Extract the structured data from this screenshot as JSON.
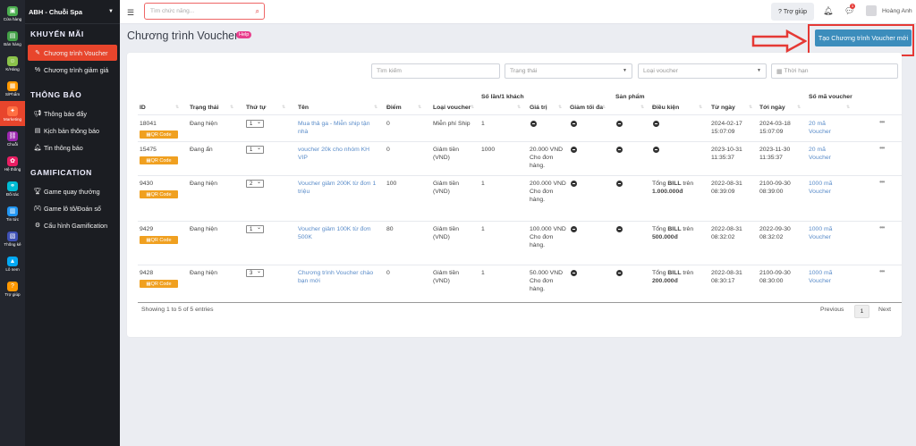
{
  "rail": [
    {
      "label": "Cửa hàng",
      "color": "#4caf50"
    },
    {
      "label": "Bán hàng",
      "color": "#43a047"
    },
    {
      "label": "K/Hàng",
      "color": "#8bc34a"
    },
    {
      "label": "S/Phẩm",
      "color": "#ff9800"
    },
    {
      "label": "Marketing",
      "color": "#ff7043",
      "active": true
    },
    {
      "label": "Chuỗi",
      "color": "#9c27b0"
    },
    {
      "label": "Hệ thống",
      "color": "#e91e63"
    },
    {
      "label": "Đối tác",
      "color": "#00bcd4"
    },
    {
      "label": "Tin tức",
      "color": "#2196f3"
    },
    {
      "label": "Thống kê",
      "color": "#3f51b5"
    },
    {
      "label": "Lô nem",
      "color": "#03a9f4"
    },
    {
      "label": "Trợ giúp",
      "color": "#ff9800"
    }
  ],
  "brand": "ABH - Chuỗi Spa",
  "sidebar": {
    "sections": [
      {
        "title": "KHUYẾN MÃI",
        "items": [
          {
            "label": "Chương trình Voucher",
            "icon": "tag-icon",
            "active": true
          },
          {
            "label": "Chương trình giảm giá",
            "icon": "percent-icon"
          }
        ]
      },
      {
        "title": "THÔNG BÁO",
        "items": [
          {
            "label": "Thông báo đẩy",
            "icon": "megaphone-icon"
          },
          {
            "label": "Kịch bản thông báo",
            "icon": "script-icon"
          },
          {
            "label": "Tin thông báo",
            "icon": "bell-icon"
          }
        ]
      },
      {
        "title": "GAMIFICATION",
        "items": [
          {
            "label": "Game quay thưởng",
            "icon": "trophy-icon"
          },
          {
            "label": "Game lô tô/Đoán số",
            "icon": "gamepad-icon"
          },
          {
            "label": "Cấu hình Gamification",
            "icon": "gear-icon"
          }
        ]
      }
    ]
  },
  "topbar": {
    "search_placeholder": "Tìm chức năng...",
    "help": "Trợ giúp",
    "user": "Hoàng Anh",
    "chat_badge": "1"
  },
  "page": {
    "title": "Chương trình Voucher",
    "help_badge": "Help",
    "create_button": "Tạo Chương trình Voucher mới"
  },
  "filters": {
    "search": "Tìm kiếm",
    "status": "Trạng thái",
    "type": "Loại voucher",
    "period": "Thời hạn"
  },
  "columns": [
    "ID",
    "Trạng thái",
    "Thứ tự",
    "Tên",
    "Điểm",
    "Loại voucher",
    "Số lần/1 khách",
    "Giá trị",
    "Giảm tối đa",
    "Sản phẩm",
    "Điều kiện",
    "Từ ngày",
    "Tới ngày",
    "Số mã voucher"
  ],
  "qr_label": "QR Code",
  "rows": [
    {
      "id": "18041",
      "status": "Đang hiện",
      "order": "1",
      "name": "Mua thả ga - Miễn ship tận nhà",
      "points": "0",
      "type": "Miễn phí Ship",
      "per_customer": "1",
      "value": "",
      "condition_pre": "",
      "condition_bold": "",
      "condition_mid": "",
      "condition_amount": "",
      "from": "2024-02-17 15:07:09",
      "to": "2024-03-18 15:07:09",
      "codes": "20 mã Voucher"
    },
    {
      "id": "15475",
      "status": "Đang ẩn",
      "order": "1",
      "name": "voucher 20k cho nhóm KH VIP",
      "points": "0",
      "type": "Giảm tiền (VND)",
      "per_customer": "1000",
      "value": "20.000 VND Cho đơn hàng.",
      "condition_pre": "",
      "condition_bold": "",
      "condition_mid": "",
      "condition_amount": "",
      "from": "2023-10-31 11:35:37",
      "to": "2023-11-30 11:35:37",
      "codes": "20 mã Voucher"
    },
    {
      "id": "9430",
      "status": "Đang hiện",
      "order": "2",
      "name": "Voucher giảm 200K từ đơn 1 triệu",
      "points": "100",
      "type": "Giảm tiền (VND)",
      "per_customer": "1",
      "value": "200.000 VND Cho đơn hàng.",
      "condition_pre": "Tổng",
      "condition_bold": "BILL",
      "condition_mid": "trên",
      "condition_amount": "1.000.000đ",
      "from": "2022-08-31 08:39:09",
      "to": "2100-09-30 08:39:00",
      "codes": "1000 mã Voucher"
    },
    {
      "id": "9429",
      "status": "Đang hiện",
      "order": "1",
      "name": "Voucher giảm 100K từ đơn 500K",
      "points": "80",
      "type": "Giảm tiền (VND)",
      "per_customer": "1",
      "value": "100.000 VND Cho đơn hàng.",
      "condition_pre": "Tổng",
      "condition_bold": "BILL",
      "condition_mid": "trên",
      "condition_amount": "500.000đ",
      "from": "2022-08-31 08:32:02",
      "to": "2022-09-30 08:32:02",
      "codes": "1000 mã Voucher"
    },
    {
      "id": "9428",
      "status": "Đang hiện",
      "order": "3",
      "name": "Chương trình Voucher chào bạn mới",
      "points": "0",
      "type": "Giảm tiền (VND)",
      "per_customer": "1",
      "value": "50.000 VND Cho đơn hàng.",
      "condition_pre": "Tổng",
      "condition_bold": "BILL",
      "condition_mid": "trên",
      "condition_amount": "200.000đ",
      "from": "2022-08-31 08:30:17",
      "to": "2100-09-30 08:30:00",
      "codes": "1000 mã Voucher"
    }
  ],
  "footer": {
    "showing": "Showing 1 to 5 of 5 entries",
    "previous": "Previous",
    "page": "1",
    "next": "Next"
  },
  "colors": {
    "accent": "#e8452c",
    "primary": "#3c8dbc",
    "qr": "#f0a020",
    "highlight": "#e53935"
  }
}
